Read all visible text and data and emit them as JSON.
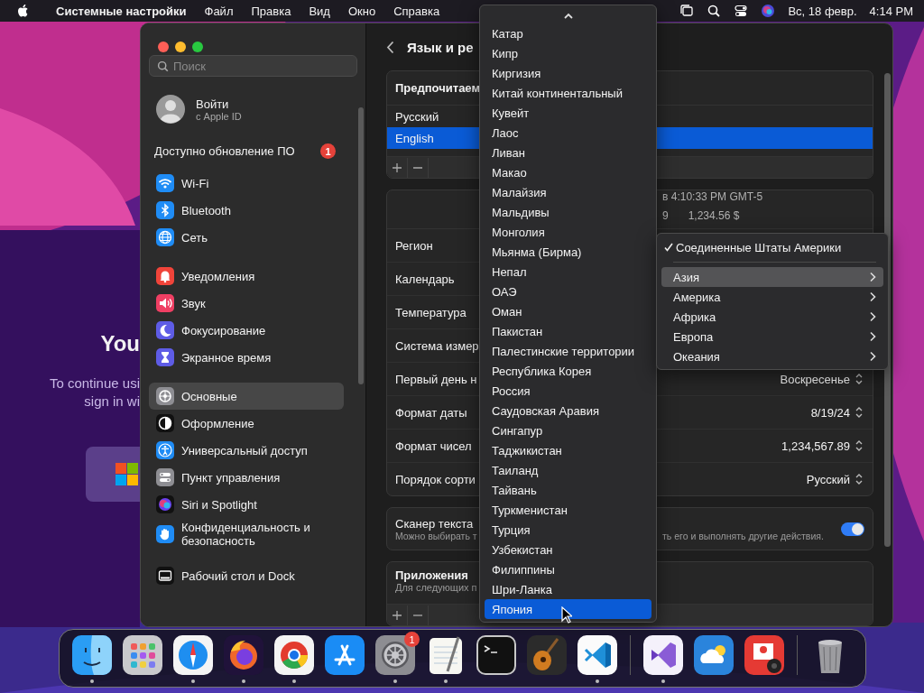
{
  "menubar": {
    "app_name": "Системные настройки",
    "menus": [
      "Файл",
      "Правка",
      "Вид",
      "Окно",
      "Справка"
    ],
    "date": "Вс, 18 февр.",
    "time": "4:14 PM"
  },
  "background_window": {
    "heading": "You",
    "lines": [
      "To continue usi",
      "sign in wi"
    ]
  },
  "sidebar": {
    "search": {
      "placeholder": "Поиск"
    },
    "account": {
      "title": "Войти",
      "subtitle": "с Apple ID"
    },
    "update": {
      "label": "Доступно обновление ПО",
      "badge": "1"
    },
    "groups": [
      [
        {
          "label": "Wi-Fi",
          "selected": false
        },
        {
          "label": "Bluetooth",
          "selected": false
        },
        {
          "label": "Сеть",
          "selected": false
        }
      ],
      [
        {
          "label": "Уведомления",
          "selected": false
        },
        {
          "label": "Звук",
          "selected": false
        },
        {
          "label": "Фокусирование",
          "selected": false
        },
        {
          "label": "Экранное время",
          "selected": false
        }
      ],
      [
        {
          "label": "Основные",
          "selected": true
        },
        {
          "label": "Оформление",
          "selected": false
        },
        {
          "label": "Универсальный доступ",
          "selected": false
        },
        {
          "label": "Пункт управления",
          "selected": false
        },
        {
          "label": "Siri и Spotlight",
          "selected": false
        },
        {
          "label": "Конфиденциальность и безопасность",
          "selected": false
        }
      ],
      [
        {
          "label": "Рабочий стол и Dock",
          "selected": false
        }
      ]
    ]
  },
  "content": {
    "title": "Язык и ре",
    "languages": {
      "header": "Предпочитаем",
      "items": [
        {
          "label": "Русский",
          "selected": false
        },
        {
          "label": "English",
          "selected": true
        }
      ]
    },
    "preview": {
      "line_1": "в 4:10:33 PM GMT-5",
      "line_2": [
        "9",
        "1,234.56 $"
      ]
    },
    "rows": [
      {
        "label": "Регион"
      },
      {
        "label": "Календарь"
      },
      {
        "label": "Температура"
      },
      {
        "label": "Система измер"
      },
      {
        "label": "Первый день н",
        "value": "Воскресенье"
      },
      {
        "label": "Формат даты",
        "value": "8/19/24"
      },
      {
        "label": "Формат чисел",
        "value": "1,234,567.89"
      },
      {
        "label": "Порядок сорти",
        "value": "Русский"
      }
    ],
    "live_text": {
      "title": "Сканер текста",
      "description": [
        "Можно выбирать т",
        "ть его и выполнять другие действия."
      ],
      "on": true
    },
    "apps": {
      "title": "Приложения",
      "description": "Для следующих п"
    }
  },
  "region_menu": {
    "items": [
      {
        "label": "Катар",
        "selected": false
      },
      {
        "label": "Кипр",
        "selected": false
      },
      {
        "label": "Киргизия",
        "selected": false
      },
      {
        "label": "Китай континентальный",
        "selected": false
      },
      {
        "label": "Кувейт",
        "selected": false
      },
      {
        "label": "Лаос",
        "selected": false
      },
      {
        "label": "Ливан",
        "selected": false
      },
      {
        "label": "Макао",
        "selected": false
      },
      {
        "label": "Малайзия",
        "selected": false
      },
      {
        "label": "Мальдивы",
        "selected": false
      },
      {
        "label": "Монголия",
        "selected": false
      },
      {
        "label": "Мьянма (Бирма)",
        "selected": false
      },
      {
        "label": "Непал",
        "selected": false
      },
      {
        "label": "ОАЭ",
        "selected": false
      },
      {
        "label": "Оман",
        "selected": false
      },
      {
        "label": "Пакистан",
        "selected": false
      },
      {
        "label": "Палестинские территории",
        "selected": false
      },
      {
        "label": "Республика Корея",
        "selected": false
      },
      {
        "label": "Россия",
        "selected": false
      },
      {
        "label": "Саудовская Аравия",
        "selected": false
      },
      {
        "label": "Сингапур",
        "selected": false
      },
      {
        "label": "Таджикистан",
        "selected": false
      },
      {
        "label": "Таиланд",
        "selected": false
      },
      {
        "label": "Тайвань",
        "selected": false
      },
      {
        "label": "Туркменистан",
        "selected": false
      },
      {
        "label": "Турция",
        "selected": false
      },
      {
        "label": "Узбекистан",
        "selected": false
      },
      {
        "label": "Филиппины",
        "selected": false
      },
      {
        "label": "Шри-Ланка",
        "selected": false
      },
      {
        "label": "Япония",
        "selected": true
      }
    ]
  },
  "region_submenu": {
    "current": {
      "label": "Соединенные Штаты Америки",
      "checked": true
    },
    "items": [
      {
        "label": "Азия",
        "selected": true
      },
      {
        "label": "Америка",
        "selected": false
      },
      {
        "label": "Африка",
        "selected": false
      },
      {
        "label": "Европа",
        "selected": false
      },
      {
        "label": "Океания",
        "selected": false
      }
    ]
  },
  "dock": {
    "groups": [
      [
        {
          "running": true
        },
        {
          "running": false
        },
        {
          "running": true
        },
        {
          "running": true
        },
        {
          "running": true
        },
        {
          "running": false
        },
        {
          "running": true,
          "badge": "1"
        },
        {
          "running": true
        },
        {
          "running": false
        },
        {
          "running": false
        },
        {
          "running": true
        }
      ],
      [
        {
          "running": true
        },
        {
          "running": false
        },
        {
          "running": false
        }
      ],
      [
        {
          "running": false
        }
      ]
    ]
  }
}
